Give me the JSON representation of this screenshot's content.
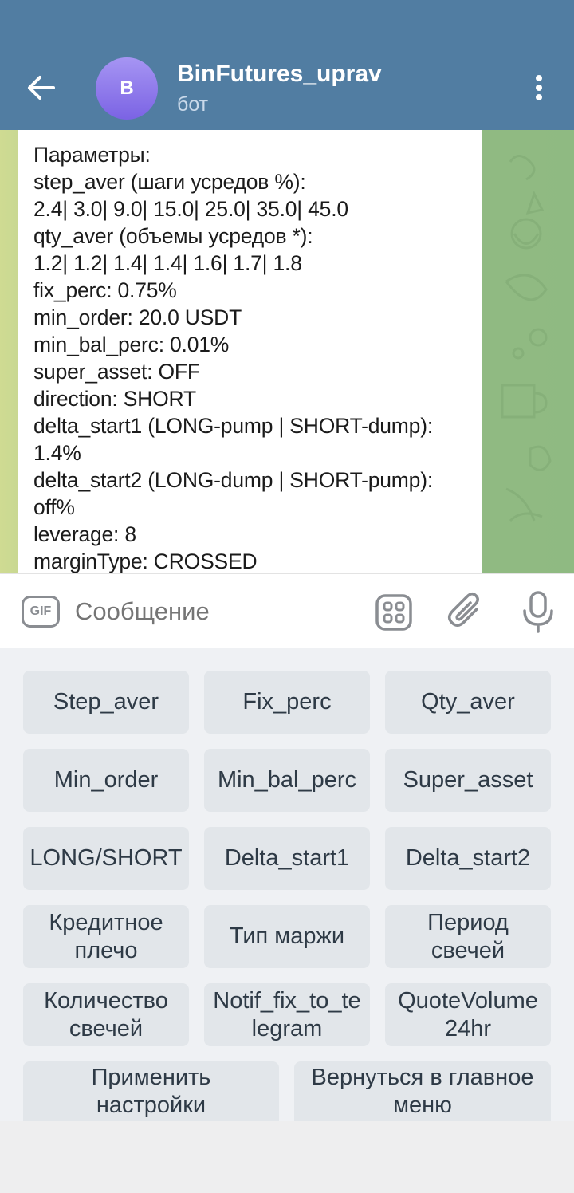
{
  "header": {
    "avatar_letter": "B",
    "title": "BinFutures_uprav",
    "subtitle": "бот"
  },
  "message": {
    "lines": [
      "Параметры:",
      "step_aver (шаги усредов %):",
      "2.4| 3.0| 9.0| 15.0| 25.0| 35.0| 45.0",
      "qty_aver (объемы усредов *):",
      "1.2| 1.2| 1.4| 1.4| 1.6| 1.7| 1.8",
      "fix_perc: 0.75%",
      "min_order: 20.0 USDT",
      "min_bal_perc: 0.01%",
      "super_asset: OFF",
      "direction: SHORT",
      "delta_start1 (LONG-pump | SHORT-dump):",
      "1.4%",
      "delta_start2 (LONG-dump | SHORT-pump):",
      "off%",
      "leverage: 8",
      "marginType: CROSSED"
    ]
  },
  "composer": {
    "gif_label": "GIF",
    "placeholder": "Сообщение"
  },
  "keyboard": {
    "rows": [
      [
        "Step_aver",
        "Fix_perc",
        "Qty_aver"
      ],
      [
        "Min_order",
        "Min_bal_perc",
        "Super_asset"
      ],
      [
        "LONG/SHORT",
        "Delta_start1",
        "Delta_start2"
      ],
      [
        [
          "Кредитное",
          "плечо"
        ],
        [
          "Тип маржи"
        ],
        [
          "Период",
          "свечей"
        ]
      ],
      [
        [
          "Количество",
          "свечей"
        ],
        [
          "Notif_fix_to_te",
          "legram"
        ],
        [
          "QuoteVolume",
          "24hr"
        ]
      ],
      [
        [
          "Применить",
          "настройки"
        ],
        [
          "Вернуться в главное",
          "меню"
        ]
      ]
    ]
  }
}
